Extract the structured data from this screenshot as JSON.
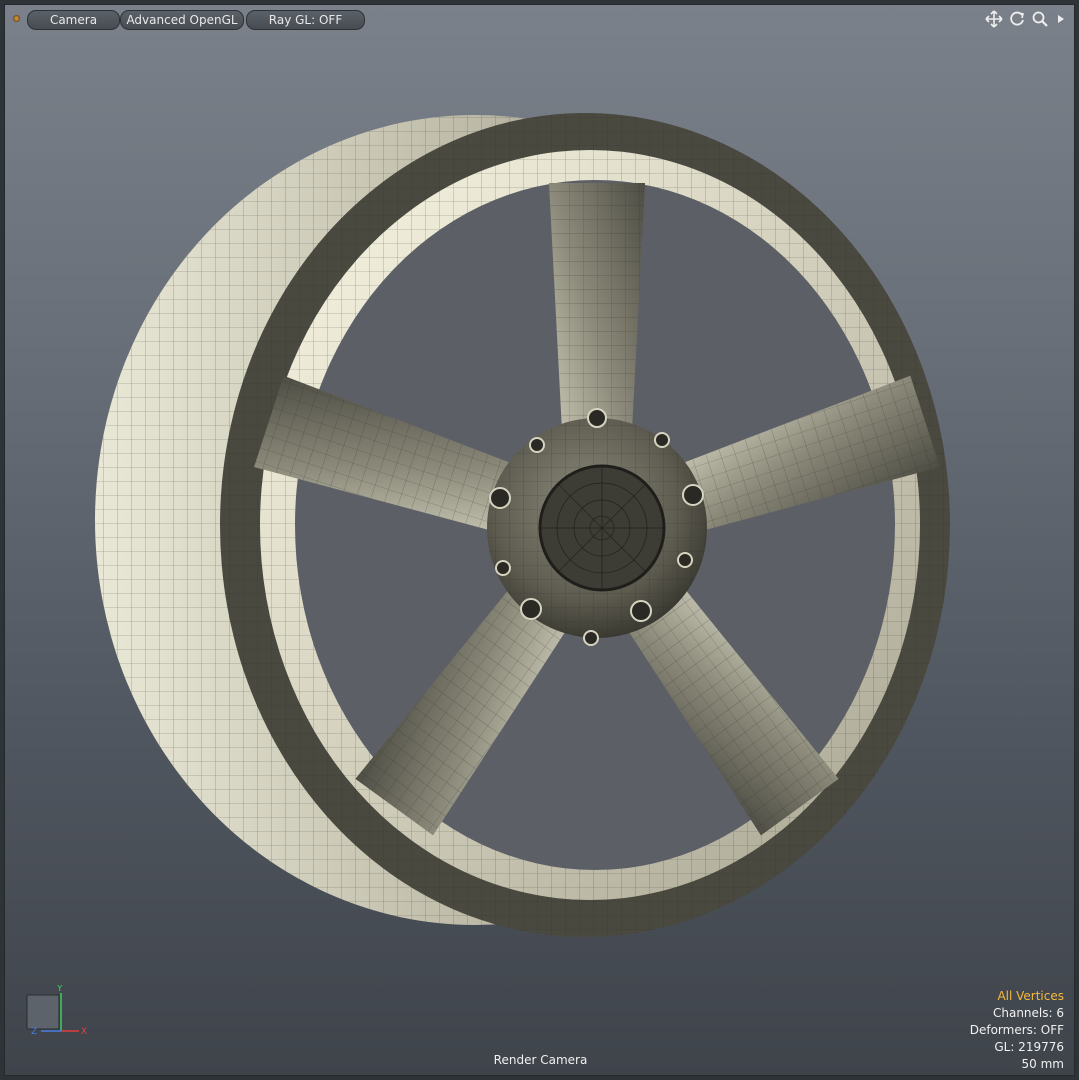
{
  "toolbar": {
    "camera_label": "Camera",
    "shading_label": "Advanced OpenGL",
    "raygl_label": "Ray GL: OFF",
    "icons": [
      "move-icon",
      "rotate-icon",
      "zoom-icon",
      "expand-arrow-icon"
    ]
  },
  "hud": {
    "selection_mode": "All Vertices",
    "channels": "Channels: 6",
    "deformers": "Deformers: OFF",
    "gl": "GL: 219776",
    "focal": "50 mm",
    "selection_color": "#f5b93a"
  },
  "viewport": {
    "camera_name": "Render Camera",
    "axis": {
      "y": "Y",
      "x": "X",
      "z": "Z"
    }
  }
}
